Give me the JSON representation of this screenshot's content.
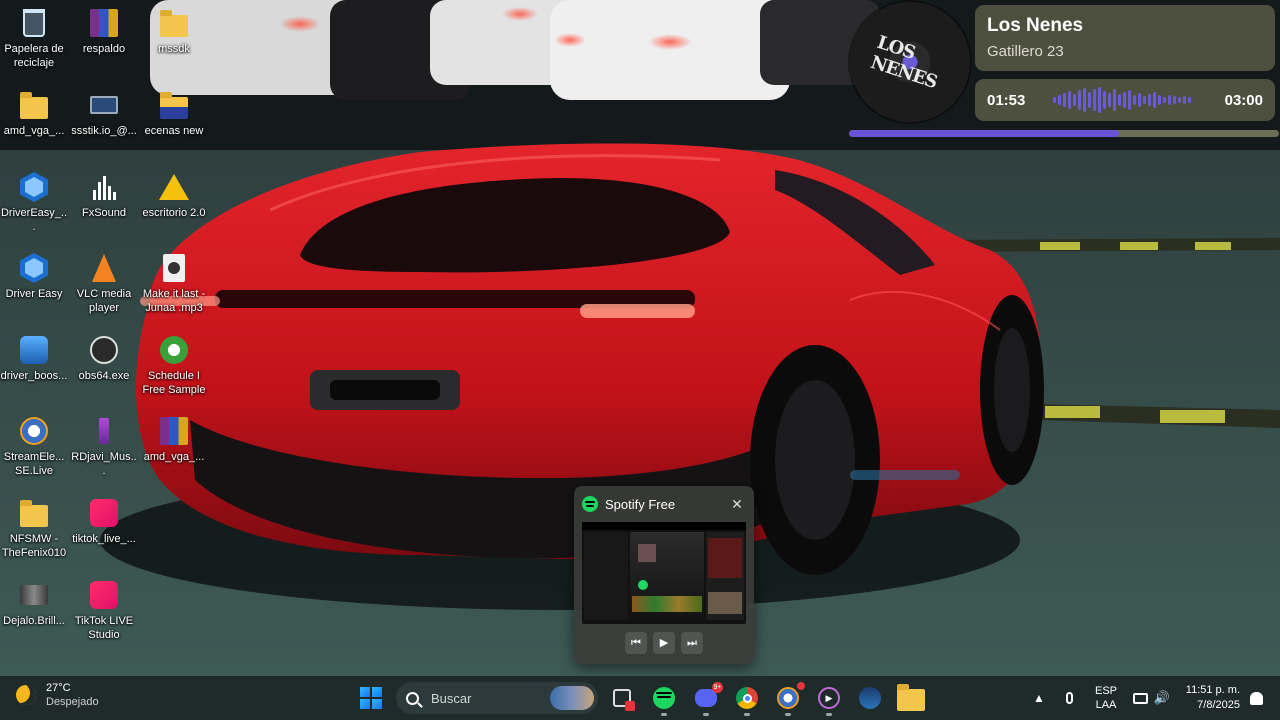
{
  "desktop": {
    "icons": [
      {
        "label": "Papelera de reciclaje",
        "icon": "recycle-bin-icon"
      },
      {
        "label": "respaldo",
        "icon": "winrar-icon"
      },
      {
        "label": "mssdk",
        "icon": "folder-icon"
      },
      {
        "label": "amd_vga_...",
        "icon": "folder-icon"
      },
      {
        "label": "ssstik.io_@...",
        "icon": "video-file-icon"
      },
      {
        "label": "ecenas new",
        "icon": "folder-icon"
      },
      {
        "label": "DriverEasy_...",
        "icon": "drivereasy-icon"
      },
      {
        "label": "FxSound",
        "icon": "fxsound-icon"
      },
      {
        "label": "escritorio 2.0",
        "icon": "warning-icon"
      },
      {
        "label": "Driver Easy",
        "icon": "drivereasy-icon"
      },
      {
        "label": "VLC media player",
        "icon": "vlc-icon"
      },
      {
        "label": "Make it last - Junaa .mp3",
        "icon": "audio-file-icon"
      },
      {
        "label": "driver_boos...",
        "icon": "driver-booster-icon"
      },
      {
        "label": "obs64.exe",
        "icon": "obs-icon"
      },
      {
        "label": "Schedule I Free Sample",
        "icon": "schedule-game-icon"
      },
      {
        "label": "StreamEle... SE.Live",
        "icon": "streamelements-icon"
      },
      {
        "label": "RDjavi_Mus...",
        "icon": "music-file-icon"
      },
      {
        "label": "amd_vga_...",
        "icon": "winrar-icon"
      },
      {
        "label": "NFSMW - TheFenix010",
        "icon": "folder-icon"
      },
      {
        "label": "tiktok_live_...",
        "icon": "tiktok-icon"
      },
      {
        "label": "Dejalo.Brill...",
        "icon": "video-file-icon"
      },
      {
        "label": "TikTok LIVE Studio",
        "icon": "tiktok-icon"
      }
    ]
  },
  "now_playing": {
    "title": "Los Nenes",
    "artist": "Gatillero 23",
    "current_time": "01:53",
    "total_time": "03:00",
    "progress_fraction": 0.628,
    "accent": "#6a52d8",
    "cover_text": "LOS NENES"
  },
  "spotify_popup": {
    "title": "Spotify Free",
    "close": "✕",
    "prev": "⏮",
    "play": "▶",
    "next": "⏭"
  },
  "taskbar": {
    "weather_temp": "27°C",
    "weather_cond": "Despejado",
    "search_placeholder": "Buscar",
    "apps": [
      "start-icon",
      "task-view-icon",
      "spotify-icon",
      "discord-icon",
      "chrome-icon",
      "streamelements-icon",
      "media-player-icon",
      "steam-icon",
      "file-explorer-icon"
    ],
    "discord_badge": "9+",
    "lang_top": "ESP",
    "lang_bottom": "LAA",
    "time": "11:51 p. m.",
    "date": "7/8/2025"
  },
  "colors": {
    "taskbar": "#1f2a2b",
    "car": "#d3161f",
    "spotify_green": "#1ed760"
  }
}
